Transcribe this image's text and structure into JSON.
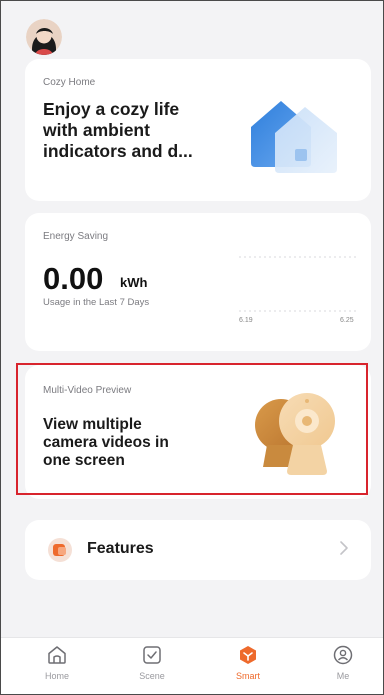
{
  "cards": {
    "cozy": {
      "label": "Cozy Home",
      "title_line1": "Enjoy a cozy life",
      "title_line2": "with ambient",
      "title_line3": "indicators and d..."
    },
    "energy": {
      "label": "Energy Saving",
      "value": "0.00",
      "unit": "kWh",
      "subtitle": "Usage in the Last 7 Days",
      "x_start": "6.19",
      "x_end": "6.25"
    },
    "video": {
      "label": "Multi-Video Preview",
      "title_line1": "View multiple",
      "title_line2": "camera videos in",
      "title_line3": "one screen"
    },
    "features": {
      "label": "Features"
    }
  },
  "tabs": [
    {
      "label": "Home",
      "icon": "home-icon",
      "active": false
    },
    {
      "label": "Scene",
      "icon": "scene-icon",
      "active": false
    },
    {
      "label": "Smart",
      "icon": "smart-icon",
      "active": true
    },
    {
      "label": "Me",
      "icon": "profile-icon",
      "active": false
    }
  ],
  "colors": {
    "accent": "#ee6a2c",
    "highlight_border": "#d8242d",
    "background": "#f3f3f5"
  }
}
